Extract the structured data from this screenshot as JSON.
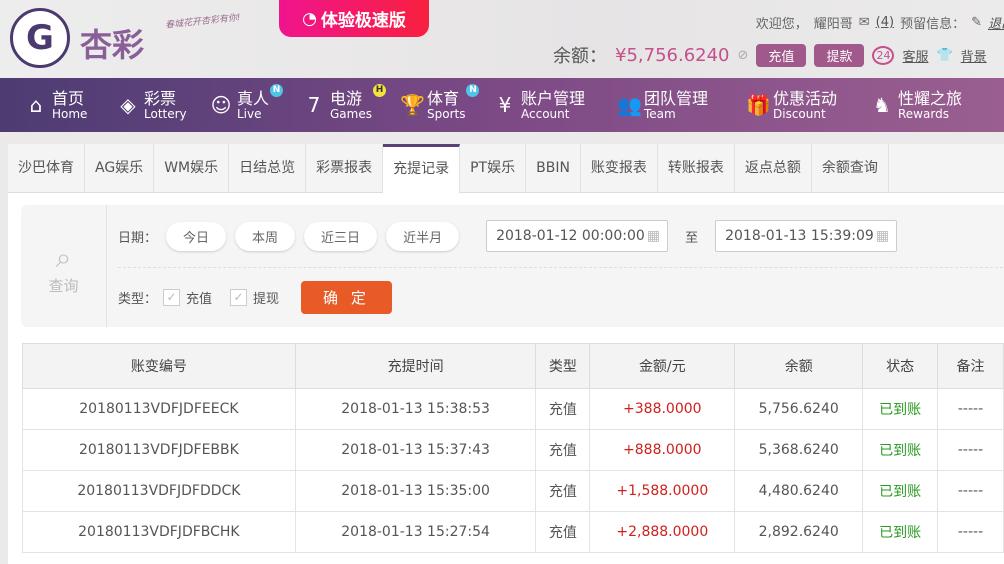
{
  "header": {
    "logo_text": "杏彩",
    "slogan": "春城花开杏彩有你!",
    "turbo_label": "体验极速版",
    "welcome": "欢迎您，",
    "username": "耀阳哥",
    "mail_count": "(4)",
    "reserved_info": "预留信息：",
    "logout": "退出",
    "balance_label": "余额：",
    "balance": "¥5,756.6240",
    "deposit": "充值",
    "withdraw": "提款",
    "support": "客服",
    "background": "背景"
  },
  "nav": [
    {
      "cn": "首页",
      "en": "Home",
      "icon": "home-icon"
    },
    {
      "cn": "彩票",
      "en": "Lottery",
      "icon": "lottery-icon"
    },
    {
      "cn": "真人",
      "en": "Live",
      "icon": "live-icon",
      "badge": "N"
    },
    {
      "cn": "电游",
      "en": "Games",
      "icon": "games-icon",
      "badge": "H"
    },
    {
      "cn": "体育",
      "en": "Sports",
      "icon": "trophy-icon",
      "badge": "N"
    },
    {
      "cn": "账户管理",
      "en": "Account",
      "icon": "yen-icon"
    },
    {
      "cn": "团队管理",
      "en": "Team",
      "icon": "team-icon"
    },
    {
      "cn": "优惠活动",
      "en": "Discount",
      "icon": "gift-icon"
    },
    {
      "cn": "性耀之旅",
      "en": "Rewards",
      "icon": "rewards-icon"
    }
  ],
  "tabs": [
    "沙巴体育",
    "AG娱乐",
    "WM娱乐",
    "日结总览",
    "彩票报表",
    "充提记录",
    "PT娱乐",
    "BBIN",
    "账变报表",
    "转账报表",
    "返点总额",
    "余额查询"
  ],
  "active_tab": "充提记录",
  "query": {
    "label": "查询",
    "date_label": "日期：",
    "quick": [
      "今日",
      "本周",
      "近三日",
      "近半月"
    ],
    "start": "2018-01-12 00:00:00",
    "to": "至",
    "end": "2018-01-13 15:39:09",
    "type_label": "类型：",
    "types": [
      "充值",
      "提现"
    ],
    "confirm": "确 定"
  },
  "table": {
    "headers": [
      "账变编号",
      "充提时间",
      "类型",
      "金额/元",
      "余额",
      "状态",
      "备注"
    ],
    "rows": [
      [
        "20180113VDFJDFEECK",
        "2018-01-13 15:38:53",
        "充值",
        "+388.0000",
        "5,756.6240",
        "已到账",
        "-----"
      ],
      [
        "20180113VDFJDFEBBK",
        "2018-01-13 15:37:43",
        "充值",
        "+888.0000",
        "5,368.6240",
        "已到账",
        "-----"
      ],
      [
        "20180113VDFJDFDDCK",
        "2018-01-13 15:35:00",
        "充值",
        "+1,588.0000",
        "4,480.6240",
        "已到账",
        "-----"
      ],
      [
        "20180113VDFJDFBCHK",
        "2018-01-13 15:27:54",
        "充值",
        "+2,888.0000",
        "2,892.6240",
        "已到账",
        "-----"
      ]
    ]
  },
  "colors": {
    "brand": "#5a3f78",
    "accent": "#c5508c",
    "confirm": "#e85a26",
    "amount": "#d0201c",
    "status": "#2a9a22"
  }
}
